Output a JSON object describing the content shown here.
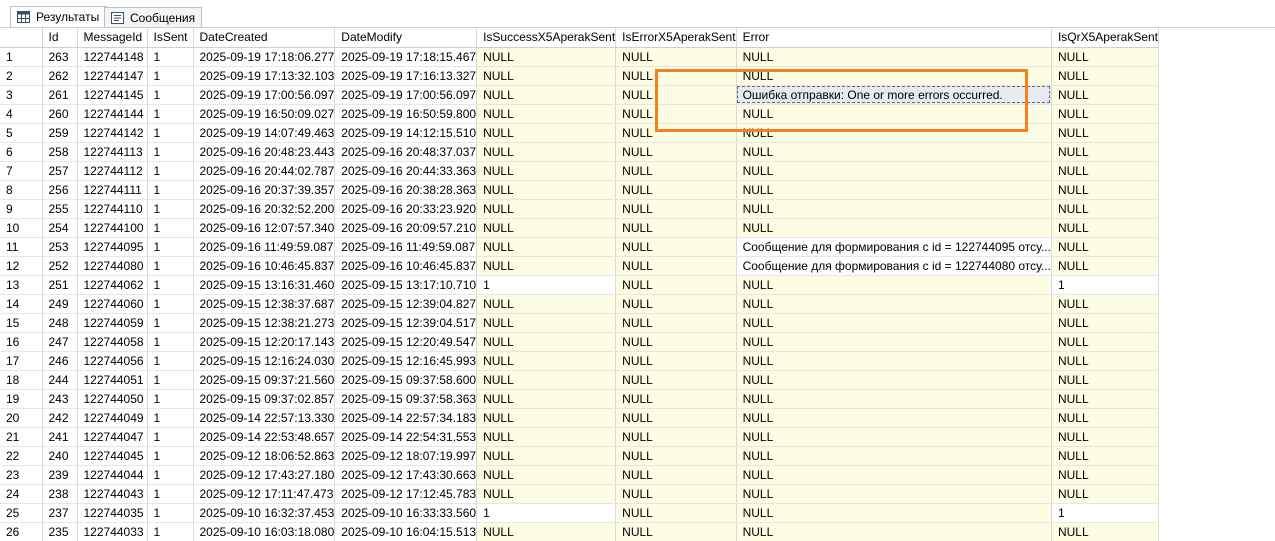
{
  "tabs": [
    {
      "label": "Результаты",
      "icon": "grid-icon",
      "active": true
    },
    {
      "label": "Сообщения",
      "icon": "messages-icon",
      "active": false
    }
  ],
  "columns": [
    "",
    "Id",
    "MessageId",
    "IsSent",
    "DateCreated",
    "DateModify",
    "IsSuccessX5AperakSent",
    "IsErrorX5AperakSent",
    "Error",
    "IsQrX5AperakSent"
  ],
  "rows": [
    [
      "1",
      "263",
      "122744148",
      "1",
      "2025-09-19 17:18:06.277",
      "2025-09-19 17:18:15.467",
      "NULL",
      "NULL",
      "NULL",
      "NULL"
    ],
    [
      "2",
      "262",
      "122744147",
      "1",
      "2025-09-19 17:13:32.103",
      "2025-09-19 17:16:13.327",
      "NULL",
      "NULL",
      "NULL",
      "NULL"
    ],
    [
      "3",
      "261",
      "122744145",
      "1",
      "2025-09-19 17:00:56.097",
      "2025-09-19 17:00:56.097",
      "NULL",
      "NULL",
      "Ошибка отправки: One or more errors occurred.",
      "NULL"
    ],
    [
      "4",
      "260",
      "122744144",
      "1",
      "2025-09-19 16:50:09.027",
      "2025-09-19 16:50:59.800",
      "NULL",
      "NULL",
      "NULL",
      "NULL"
    ],
    [
      "5",
      "259",
      "122744142",
      "1",
      "2025-09-19 14:07:49.463",
      "2025-09-19 14:12:15.510",
      "NULL",
      "NULL",
      "NULL",
      "NULL"
    ],
    [
      "6",
      "258",
      "122744113",
      "1",
      "2025-09-16 20:48:23.443",
      "2025-09-16 20:48:37.037",
      "NULL",
      "NULL",
      "NULL",
      "NULL"
    ],
    [
      "7",
      "257",
      "122744112",
      "1",
      "2025-09-16 20:44:02.787",
      "2025-09-16 20:44:33.363",
      "NULL",
      "NULL",
      "NULL",
      "NULL"
    ],
    [
      "8",
      "256",
      "122744111",
      "1",
      "2025-09-16 20:37:39.357",
      "2025-09-16 20:38:28.363",
      "NULL",
      "NULL",
      "NULL",
      "NULL"
    ],
    [
      "9",
      "255",
      "122744110",
      "1",
      "2025-09-16 20:32:52.200",
      "2025-09-16 20:33:23.920",
      "NULL",
      "NULL",
      "NULL",
      "NULL"
    ],
    [
      "10",
      "254",
      "122744100",
      "1",
      "2025-09-16 12:07:57.340",
      "2025-09-16 20:09:57.210",
      "NULL",
      "NULL",
      "NULL",
      "NULL"
    ],
    [
      "11",
      "253",
      "122744095",
      "1",
      "2025-09-16 11:49:59.087",
      "2025-09-16 11:49:59.087",
      "NULL",
      "NULL",
      "Сообщение для формирования с id = 122744095 отсу...",
      "NULL"
    ],
    [
      "12",
      "252",
      "122744080",
      "1",
      "2025-09-16 10:46:45.837",
      "2025-09-16 10:46:45.837",
      "NULL",
      "NULL",
      "Сообщение для формирования с id = 122744080 отсу...",
      "NULL"
    ],
    [
      "13",
      "251",
      "122744062",
      "1",
      "2025-09-15 13:16:31.460",
      "2025-09-15 13:17:10.710",
      "1",
      "NULL",
      "NULL",
      "1"
    ],
    [
      "14",
      "249",
      "122744060",
      "1",
      "2025-09-15 12:38:37.687",
      "2025-09-15 12:39:04.827",
      "NULL",
      "NULL",
      "NULL",
      "NULL"
    ],
    [
      "15",
      "248",
      "122744059",
      "1",
      "2025-09-15 12:38:21.273",
      "2025-09-15 12:39:04.517",
      "NULL",
      "NULL",
      "NULL",
      "NULL"
    ],
    [
      "16",
      "247",
      "122744058",
      "1",
      "2025-09-15 12:20:17.143",
      "2025-09-15 12:20:49.547",
      "NULL",
      "NULL",
      "NULL",
      "NULL"
    ],
    [
      "17",
      "246",
      "122744056",
      "1",
      "2025-09-15 12:16:24.030",
      "2025-09-15 12:16:45.993",
      "NULL",
      "NULL",
      "NULL",
      "NULL"
    ],
    [
      "18",
      "244",
      "122744051",
      "1",
      "2025-09-15 09:37:21.560",
      "2025-09-15 09:37:58.600",
      "NULL",
      "NULL",
      "NULL",
      "NULL"
    ],
    [
      "19",
      "243",
      "122744050",
      "1",
      "2025-09-15 09:37:02.857",
      "2025-09-15 09:37:58.363",
      "NULL",
      "NULL",
      "NULL",
      "NULL"
    ],
    [
      "20",
      "242",
      "122744049",
      "1",
      "2025-09-14 22:57:13.330",
      "2025-09-14 22:57:34.183",
      "NULL",
      "NULL",
      "NULL",
      "NULL"
    ],
    [
      "21",
      "241",
      "122744047",
      "1",
      "2025-09-14 22:53:48.657",
      "2025-09-14 22:54:31.553",
      "NULL",
      "NULL",
      "NULL",
      "NULL"
    ],
    [
      "22",
      "240",
      "122744045",
      "1",
      "2025-09-12 18:06:52.863",
      "2025-09-12 18:07:19.997",
      "NULL",
      "NULL",
      "NULL",
      "NULL"
    ],
    [
      "23",
      "239",
      "122744044",
      "1",
      "2025-09-12 17:43:27.180",
      "2025-09-12 17:43:30.663",
      "NULL",
      "NULL",
      "NULL",
      "NULL"
    ],
    [
      "24",
      "238",
      "122744043",
      "1",
      "2025-09-12 17:11:47.473",
      "2025-09-12 17:12:45.783",
      "NULL",
      "NULL",
      "NULL",
      "NULL"
    ],
    [
      "25",
      "237",
      "122744035",
      "1",
      "2025-09-10 16:32:37.453",
      "2025-09-10 16:33:33.560",
      "1",
      "NULL",
      "NULL",
      "1"
    ],
    [
      "26",
      "235",
      "122744033",
      "1",
      "2025-09-10 16:03:18.080",
      "2025-09-10 16:04:15.513",
      "NULL",
      "NULL",
      "NULL",
      "NULL"
    ]
  ],
  "selected_cell": {
    "row": 2,
    "col": 8
  },
  "colors": {
    "highlight": "#f58220",
    "null_bg": "#fdfde3"
  }
}
